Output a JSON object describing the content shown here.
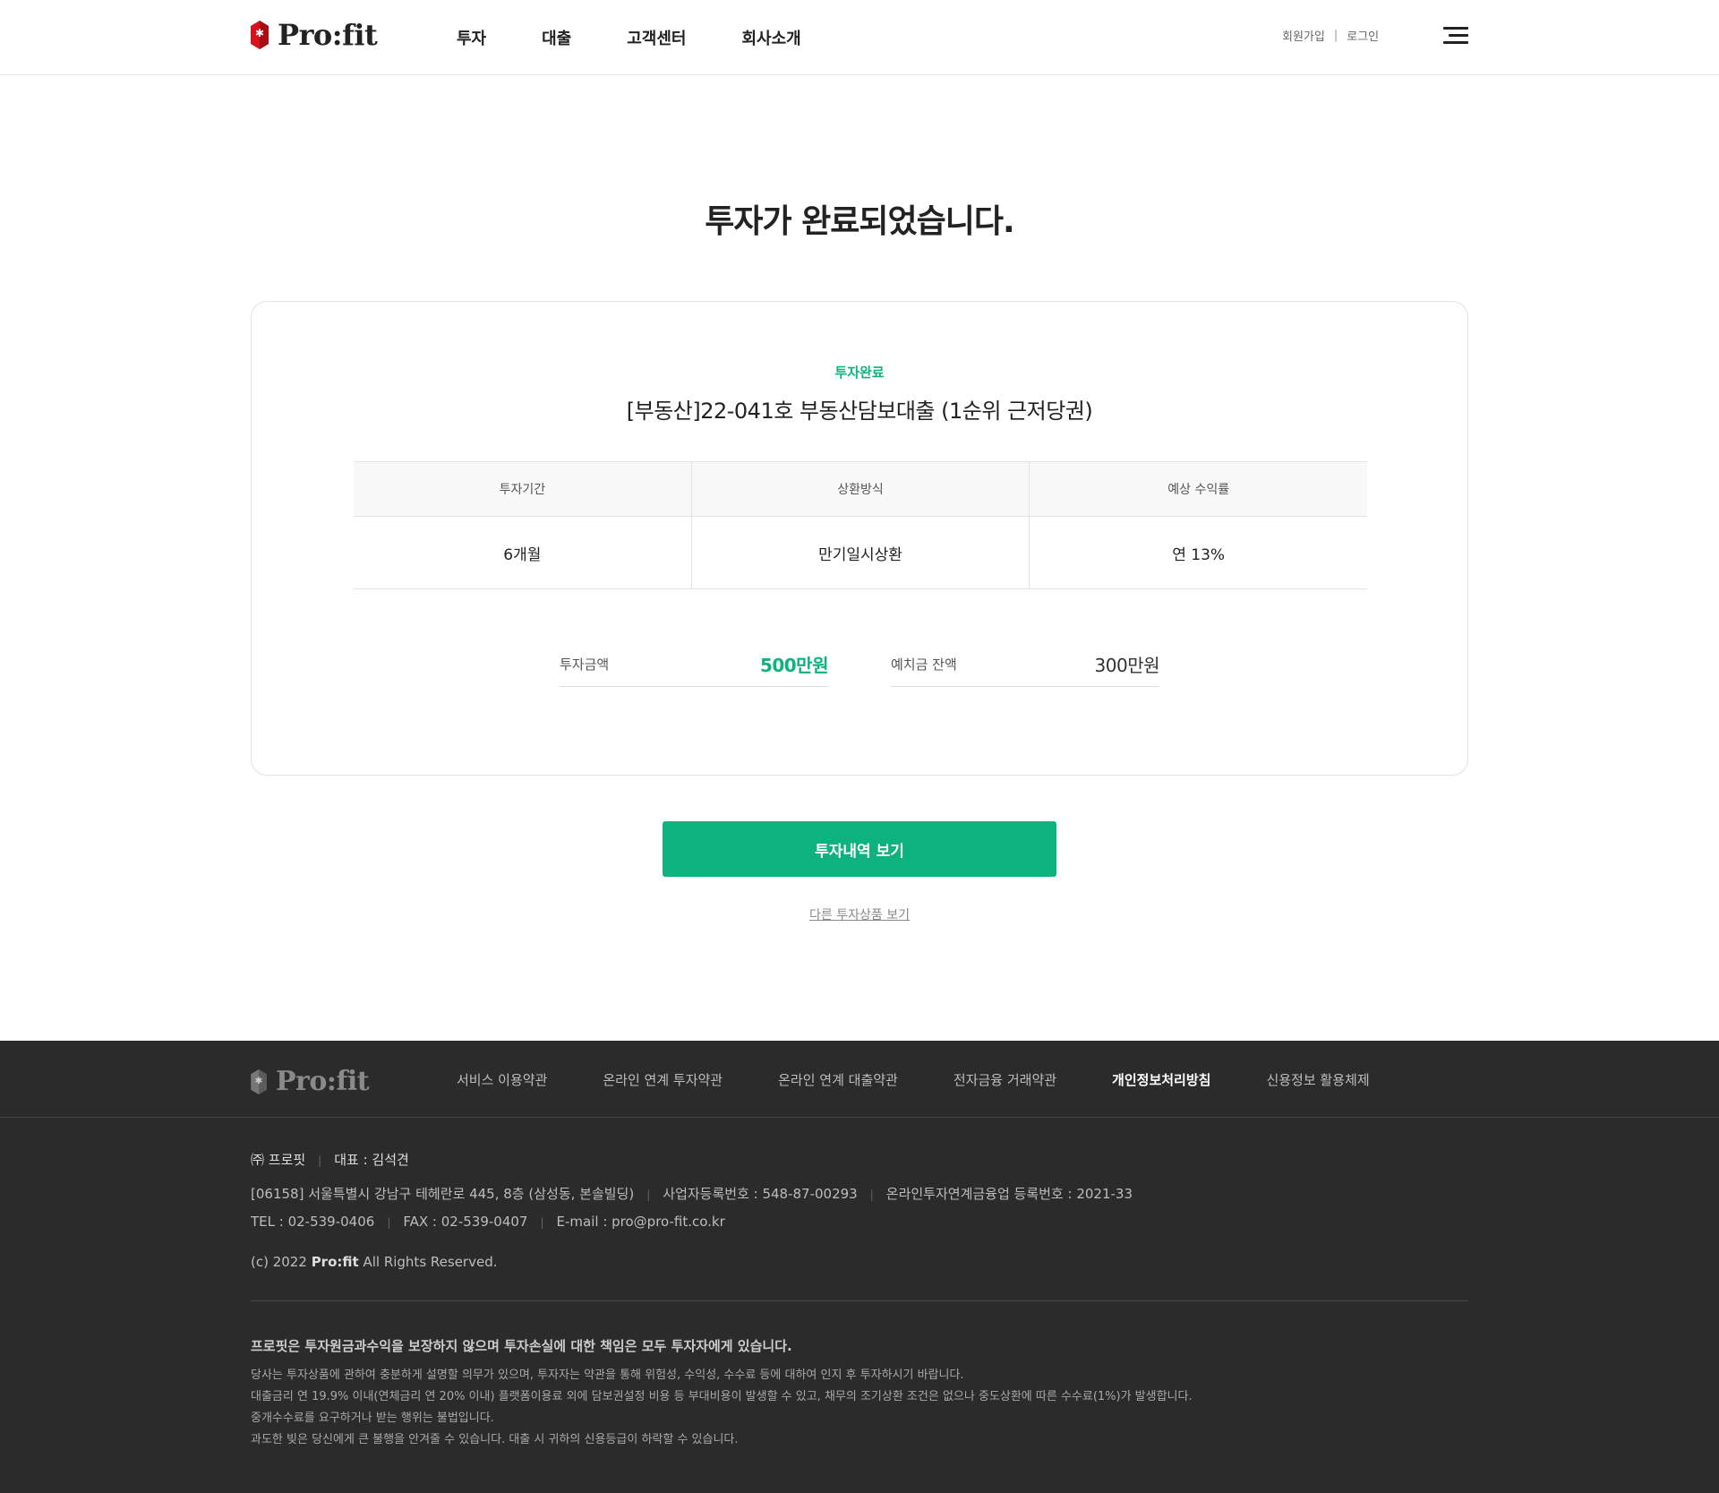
{
  "brand": {
    "name": "Pro:fit",
    "accent": "#0eb27c",
    "logo_red": "#d7121c"
  },
  "header": {
    "nav": [
      "투자",
      "대출",
      "고객센터",
      "회사소개"
    ],
    "signup": "회원가입",
    "login": "로그인",
    "menu_icon": "hamburger-icon"
  },
  "main": {
    "title": "투자가 완료되었습니다.",
    "badge": "투자완료",
    "product": "[부동산]22-041호 부동산담보대출 (1순위 근저당권)",
    "table": {
      "headers": [
        "투자기간",
        "상환방식",
        "예상 수익률"
      ],
      "values": [
        "6개월",
        "만기일시상환",
        "연 13%"
      ]
    },
    "invest_label": "투자금액",
    "invest_value": "500만원",
    "deposit_label": "예치금 잔액",
    "deposit_value": "300만원",
    "primary_button": "투자내역 보기",
    "secondary_link": "다른 투자상품 보기"
  },
  "footer": {
    "nav": [
      "서비스 이용약관",
      "온라인 연계 투자약관",
      "온라인 연계 대출약관",
      "전자금융 거래약관",
      "개인정보처리방침",
      "신용정보 활용체제"
    ],
    "company": "㈜ 프로핏",
    "ceo": "대표 : 김석견",
    "address": "[06158] 서울특별시 강남구 테헤란로 445, 8층 (삼성동, 본솔빌딩)",
    "biz_no": "사업자등록번호 : 548-87-00293",
    "p2p_no": "온라인투자연계금융업 등록번호 : 2021-33",
    "tel": "TEL : 02-539-0406",
    "fax": "FAX : 02-539-0407",
    "email": "E-mail : pro@pro-fit.co.kr",
    "copy_prefix": "(c) 2022",
    "copy_brand": "Pro:fit",
    "copy_suffix": "All Rights Reserved.",
    "warning": "프로핏은 투자원금과수익을 보장하지 않으며 투자손실에 대한 책임은 모두 투자자에게 있습니다.",
    "notes": [
      "당사는 투자상품에 관하여 충분하게 설명할 의무가 있으며, 투자자는 약관을 통해 위험성, 수익성, 수수료 등에 대하여 인지 후 투자하시기 바랍니다.",
      "대출금리 연 19.9% 이내(연체금리 연 20% 이내) 플랫폼이용료 외에 담보권설정 비용 등 부대비용이 발생할 수 있고, 채무의 조기상환 조건은 없으나 중도상환에 따른 수수료(1%)가 발생합니다.",
      "중개수수료를 요구하거나 받는 행위는 불법입니다.",
      "과도한 빚은 당신에게 큰 불행을 안겨줄 수 있습니다. 대출 시 귀하의 신용등급이 하락할 수 있습니다."
    ]
  }
}
